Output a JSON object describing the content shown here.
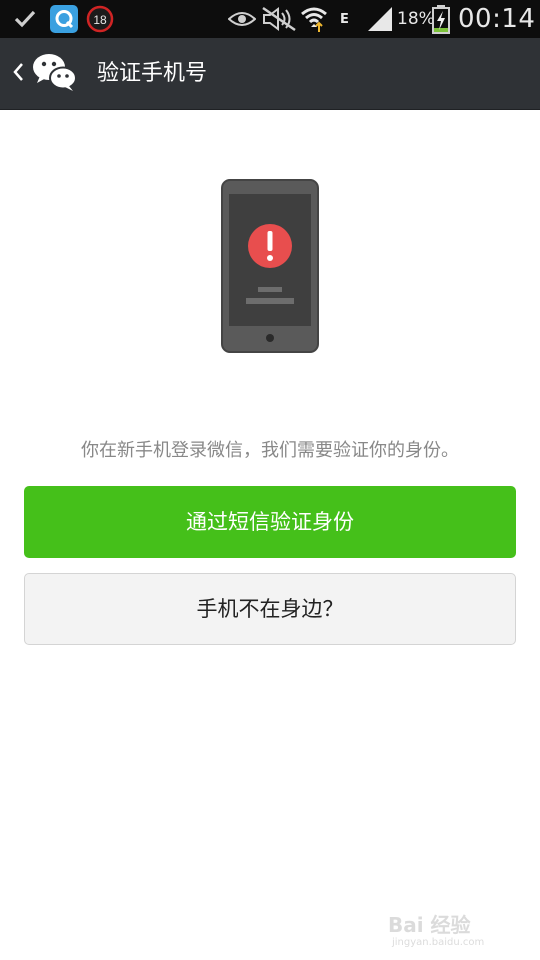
{
  "status_bar": {
    "notification_badge": "18",
    "battery_percent": "18%",
    "network_type": "E",
    "time": "00:14",
    "icons": [
      "check-icon",
      "app-q-icon",
      "eye-icon",
      "mute-icon",
      "wifi-icon",
      "signal-icon",
      "battery-charging-icon"
    ]
  },
  "header": {
    "title": "验证手机号",
    "icons": [
      "back-chevron-icon",
      "wechat-logo-icon"
    ]
  },
  "main": {
    "message": "你在新手机登录微信，我们需要验证你的身份。",
    "primary_button": "通过短信验证身份",
    "secondary_button": "手机不在身边？",
    "illustration_icon": "phone-alert-icon"
  },
  "watermark": {
    "text": "Bai 经验",
    "sub": "jingyan.baidu.com"
  },
  "colors": {
    "status_bar_bg": "#0d0d0d",
    "header_bg": "#2f3236",
    "primary_green": "#45c01a",
    "alert_red": "#e84e4e",
    "message_gray": "#888888"
  }
}
